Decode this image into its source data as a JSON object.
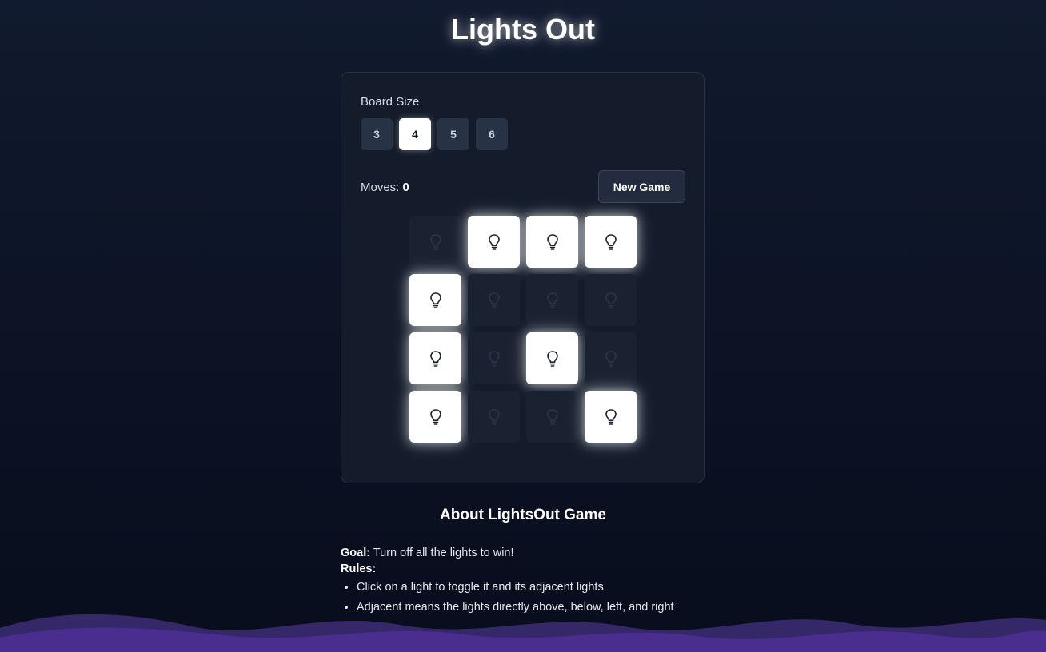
{
  "header": {
    "title": "Lights Out"
  },
  "board_size": {
    "label": "Board Size",
    "options": [
      "3",
      "4",
      "5",
      "6"
    ],
    "selected": "4"
  },
  "status": {
    "moves_label": "Moves:",
    "moves_value": "0"
  },
  "controls": {
    "new_game_label": "New Game"
  },
  "grid": {
    "rows": 4,
    "cols": 4,
    "cells": [
      [
        false,
        true,
        true,
        true
      ],
      [
        true,
        false,
        false,
        false
      ],
      [
        true,
        false,
        true,
        false
      ],
      [
        true,
        false,
        false,
        true
      ]
    ],
    "icon": "lightbulb-icon"
  },
  "about": {
    "title": "About LightsOut Game",
    "goal_label": "Goal:",
    "goal_text": " Turn off all the lights to win!",
    "rules_label": "Rules:",
    "rules": [
      "Click on a light to toggle it and its adjacent lights",
      "Adjacent means the lights directly above, below, left, and right"
    ]
  },
  "colors": {
    "light_on": "#ffffff",
    "light_off": "#1a2232",
    "background": "#0c1426",
    "wave": "#5b3fa8"
  }
}
